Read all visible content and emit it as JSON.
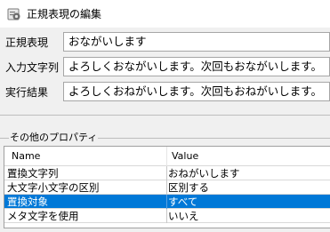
{
  "window": {
    "title": "正規表現の編集",
    "icon": "settings-dialog-icon"
  },
  "fields": {
    "regex": {
      "label": "正規表現",
      "value": "おながいします"
    },
    "input": {
      "label": "入力文字列",
      "value": "よろしくおながいします。次回もおながいします。"
    },
    "result": {
      "label": "実行結果",
      "value": "よろしくおねがいします。次回もおねがいします。"
    }
  },
  "properties": {
    "group_title": "その他のプロパティ",
    "columns": {
      "name": "Name",
      "value": "Value"
    },
    "rows": [
      {
        "name": "置換文字列",
        "value": "おねがいします",
        "selected": false
      },
      {
        "name": "大文字小文字の区別",
        "value": "区別する",
        "selected": false
      },
      {
        "name": "置換対象",
        "value": "すべて",
        "selected": true
      },
      {
        "name": "メタ文字を使用",
        "value": "いいえ",
        "selected": false
      }
    ]
  },
  "colors": {
    "selection": "#0078d7",
    "window_bg": "#f0f0f0"
  }
}
